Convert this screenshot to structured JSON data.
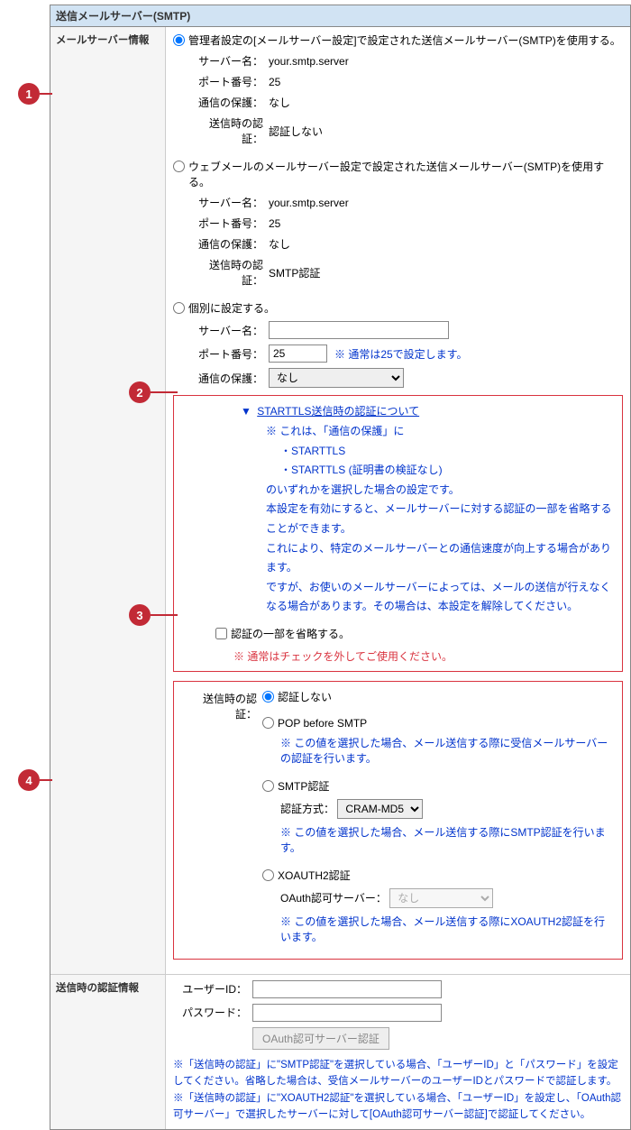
{
  "badges": {
    "b1": "1",
    "b2": "2",
    "b3": "3",
    "b4": "4"
  },
  "title": "送信メールサーバー(SMTP)",
  "section1": {
    "label": "メールサーバー情報",
    "opt1": {
      "radio_label": "管理者設定の[メールサーバー設定]で設定された送信メールサーバー(SMTP)を使用する。",
      "server_label": "サーバー名：",
      "server_value": "your.smtp.server",
      "port_label": "ポート番号：",
      "port_value": "25",
      "secure_label": "通信の保護：",
      "secure_value": "なし",
      "auth_label": "送信時の認証：",
      "auth_value": "認証しない"
    },
    "opt2": {
      "radio_label": "ウェブメールのメールサーバー設定で設定された送信メールサーバー(SMTP)を使用する。",
      "server_label": "サーバー名：",
      "server_value": "your.smtp.server",
      "port_label": "ポート番号：",
      "port_value": "25",
      "secure_label": "通信の保護：",
      "secure_value": "なし",
      "auth_label": "送信時の認証：",
      "auth_value": "SMTP認証"
    },
    "opt3": {
      "radio_label": "個別に設定する。",
      "server_label": "サーバー名：",
      "port_label": "ポート番号：",
      "port_value": "25",
      "port_note": "※ 通常は25で設定します。",
      "secure_label": "通信の保護：",
      "secure_value": "なし"
    },
    "starttls": {
      "link": "STARTTLS送信時の認証について",
      "line1": "※ これは、「通信の保護」に",
      "bullet1": "・STARTTLS",
      "bullet2": "・STARTTLS (証明書の検証なし)",
      "line2": "のいずれかを選択した場合の設定です。",
      "line3": "本設定を有効にすると、メールサーバーに対する認証の一部を省略することができます。",
      "line4": "これにより、特定のメールサーバーとの通信速度が向上する場合があります。",
      "line5": "ですが、お使いのメールサーバーによっては、メールの送信が行えなくなる場合があります。その場合は、本設定を解除してください。",
      "checkbox_label": "認証の一部を省略する。",
      "red_note": "※ 通常はチェックを外してご使用ください。"
    },
    "sendauth": {
      "label": "送信時の認証：",
      "opt1": "認証しない",
      "opt2": "POP before SMTP",
      "opt2_note": "※ この値を選択した場合、メール送信する際に受信メールサーバーの認証を行います。",
      "opt3": "SMTP認証",
      "opt3_method_label": "認証方式：",
      "opt3_method_value": "CRAM-MD5",
      "opt3_note": "※ この値を選択した場合、メール送信する際にSMTP認証を行います。",
      "opt4": "XOAUTH2認証",
      "opt4_server_label": "OAuth認可サーバー：",
      "opt4_server_value": "なし",
      "opt4_note": "※ この値を選択した場合、メール送信する際にXOAUTH2認証を行います。"
    }
  },
  "section2": {
    "label": "送信時の認証情報",
    "user_label": "ユーザーID：",
    "pass_label": "パスワード：",
    "button": "OAuth認可サーバー認証",
    "note1": "※「送信時の認証」に\"SMTP認証\"を選択している場合、「ユーザーID」と「パスワード」を設定してください。省略した場合は、受信メールサーバーのユーザーIDとパスワードで認証します。",
    "note2": "※「送信時の認証」に\"XOAUTH2認証\"を選択している場合、「ユーザーID」を設定し、「OAuth認可サーバー」で選択したサーバーに対して[OAuth認可サーバー認証]で認証してください。"
  }
}
